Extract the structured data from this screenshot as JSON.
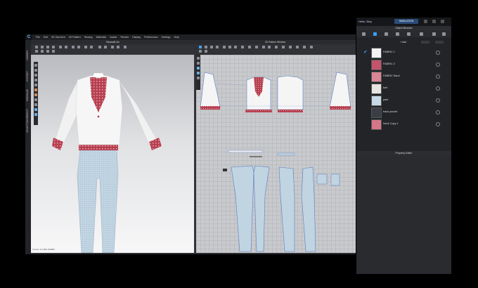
{
  "app": {
    "logo": "C",
    "menu": [
      "File",
      "Edit",
      "3D Garment",
      "2D Pattern",
      "Sewing",
      "Materials",
      "Avatar",
      "Render",
      "Display",
      "Preferences",
      "Settings",
      "Help"
    ],
    "side_tabs": [
      "LIBRARY",
      "HISTORY",
      "MODULAR",
      "SCULPTING/OBJECT"
    ],
    "panel3d_title": "Tabasal6.Zrn",
    "panel2d_title": "2D Pattern Window",
    "version": "Version 6.0.960 (39985)"
  },
  "right_panel": {
    "greeting": "Hello, Bicy",
    "simulation_label": "SIMULATION",
    "object_browser_title": "Object Browser",
    "add_label": "+ Add",
    "items": [
      {
        "name": "FABRIC 1",
        "swatch": "#f2f2f2",
        "checked": true
      },
      {
        "name": "FABRIC 2",
        "swatch": "#c4546b",
        "checked": false
      },
      {
        "name": "FABRIC Sand",
        "swatch": "#d98596",
        "checked": false
      },
      {
        "name": "belt",
        "swatch": "#e8e4df",
        "checked": false
      },
      {
        "name": "pant",
        "swatch": "#c6d9e6",
        "checked": false
      },
      {
        "name": "back pocket",
        "swatch": "#3b3e45",
        "checked": false
      },
      {
        "name": "Neck Copy 1",
        "swatch": "#d67788",
        "checked": false
      }
    ],
    "property_editor_title": "Property Editor"
  }
}
